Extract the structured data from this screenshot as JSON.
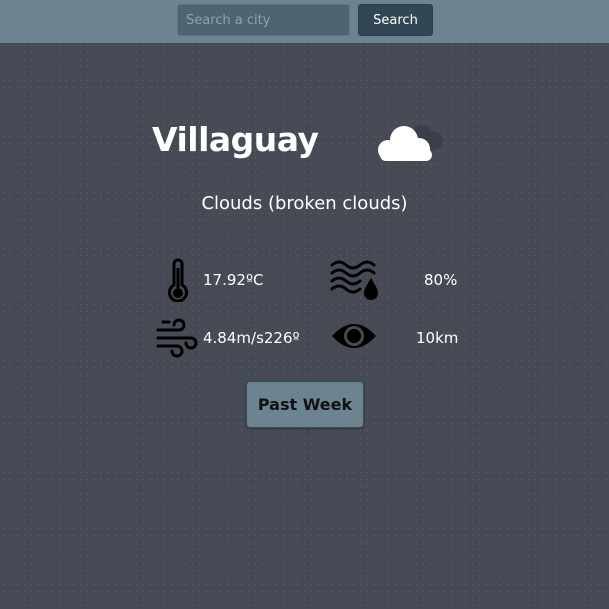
{
  "search": {
    "placeholder": "Search a city",
    "value": "",
    "button_label": "Search"
  },
  "weather": {
    "city": "Villaguay",
    "condition_icon": "cloud-icon",
    "description": "Clouds (broken clouds)"
  },
  "metrics": {
    "temperature": {
      "icon": "thermometer-icon",
      "value": "17.92ºC"
    },
    "humidity": {
      "icon": "humidity-icon",
      "value": "80%"
    },
    "wind": {
      "icon": "wind-icon",
      "value": "4.84m/s226º"
    },
    "visibility": {
      "icon": "eye-icon",
      "value": "10km"
    }
  },
  "actions": {
    "past_week_label": "Past Week"
  },
  "colors": {
    "background": "#454a55",
    "topbar": "#6c8390",
    "search_button": "#324654",
    "accent_button": "#6c8390",
    "text": "#ffffff"
  }
}
